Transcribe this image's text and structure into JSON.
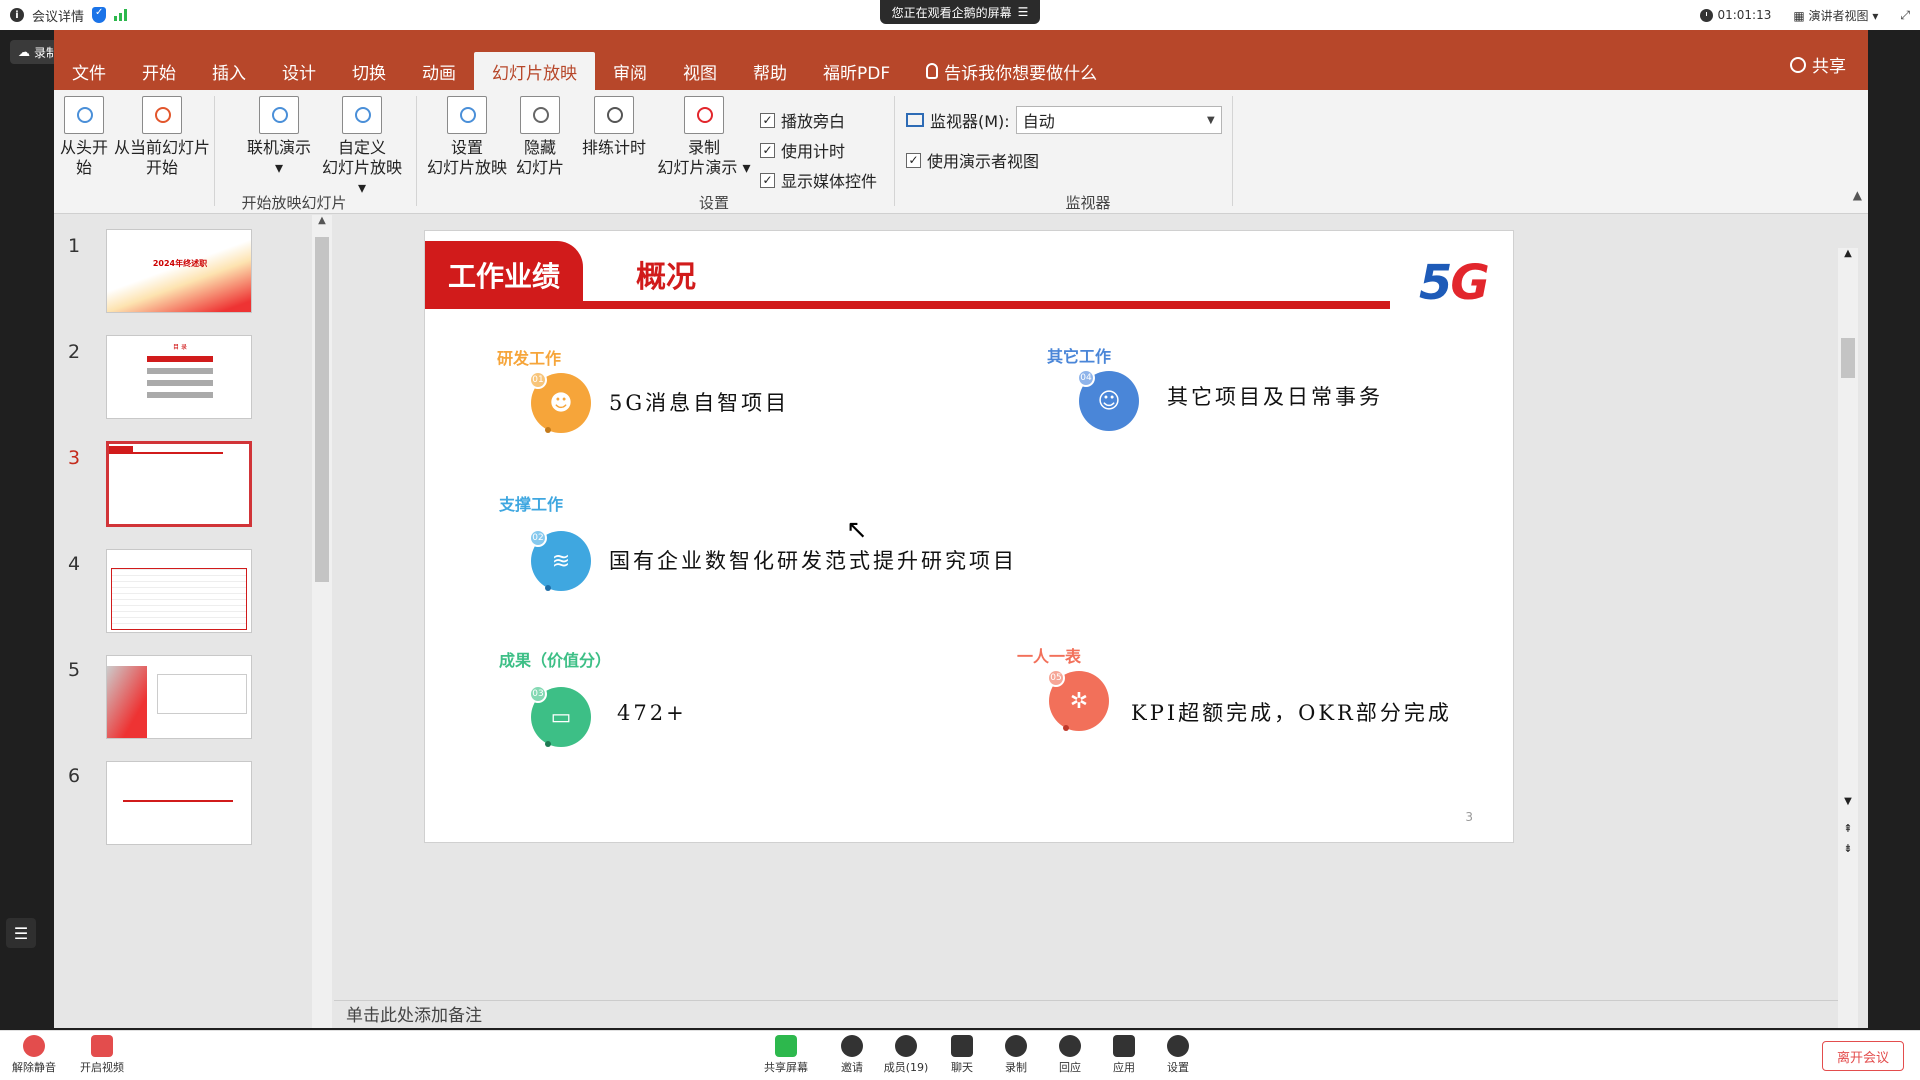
{
  "meeting_top": {
    "details": "会议详情",
    "watching": "您正在观看企鹅的屏幕",
    "timer": "01:01:13",
    "view_mode": "演讲者视图"
  },
  "recording_badge": "录制中",
  "ribbon_tabs": [
    {
      "label": "文件"
    },
    {
      "label": "开始"
    },
    {
      "label": "插入"
    },
    {
      "label": "设计"
    },
    {
      "label": "切换"
    },
    {
      "label": "动画"
    },
    {
      "label": "幻灯片放映",
      "active": true
    },
    {
      "label": "审阅"
    },
    {
      "label": "视图"
    },
    {
      "label": "帮助"
    },
    {
      "label": "福昕PDF"
    }
  ],
  "tell_me": "告诉我你想要做什么",
  "share_label": "共享",
  "ribbon": {
    "from_beginning": "从头开始",
    "from_current": "从当前幻灯片",
    "from_current_2": "开始",
    "online": "联机演示",
    "custom": "自定义",
    "custom_2": "幻灯片放映",
    "group_start": "开始放映幻灯片",
    "setup": "设置",
    "setup_2": "幻灯片放映",
    "hide": "隐藏",
    "hide_2": "幻灯片",
    "rehearse": "排练计时",
    "record": "录制",
    "record_2": "幻灯片演示",
    "chk_narration": "播放旁白",
    "chk_timing": "使用计时",
    "chk_media": "显示媒体控件",
    "group_setup": "设置",
    "monitor_label": "监视器(M):",
    "monitor_value": "自动",
    "presenter_view": "使用演示者视图",
    "group_monitor": "监视器"
  },
  "thumbnails": [
    {
      "num": "1",
      "title": "2024年终述职"
    },
    {
      "num": "2",
      "title": "目 录"
    },
    {
      "num": "3",
      "active": true
    },
    {
      "num": "4"
    },
    {
      "num": "5"
    },
    {
      "num": "6"
    }
  ],
  "slide": {
    "header_badge": "工作业绩",
    "title": "概况",
    "logo": "5G",
    "page": "3",
    "items": [
      {
        "section": "研发工作",
        "num": "01",
        "text": "5G消息自智项目",
        "color": "#f6a53a"
      },
      {
        "section": "支撑工作",
        "num": "02",
        "text": "国有企业数智化研发范式提升研究项目",
        "color": "#3fa7e0"
      },
      {
        "section": "成果（价值分）",
        "num": "03",
        "text": "472+",
        "color": "#3dbf86"
      },
      {
        "section": "其它工作",
        "num": "04",
        "text": "其它项目及日常事务",
        "color": "#4a86d8"
      },
      {
        "section": "一人一表",
        "num": "05",
        "text": "KPI超额完成，OKR部分完成",
        "color": "#f2705a"
      }
    ]
  },
  "notes_placeholder": "单击此处添加备注",
  "bottom_bar": {
    "mute": "解除静音",
    "video": "开启视频",
    "share": "共享屏幕",
    "invite": "邀请",
    "members": "成员(19)",
    "chat": "聊天",
    "record": "录制",
    "react": "回应",
    "apps": "应用",
    "settings": "设置",
    "leave": "离开会议"
  }
}
